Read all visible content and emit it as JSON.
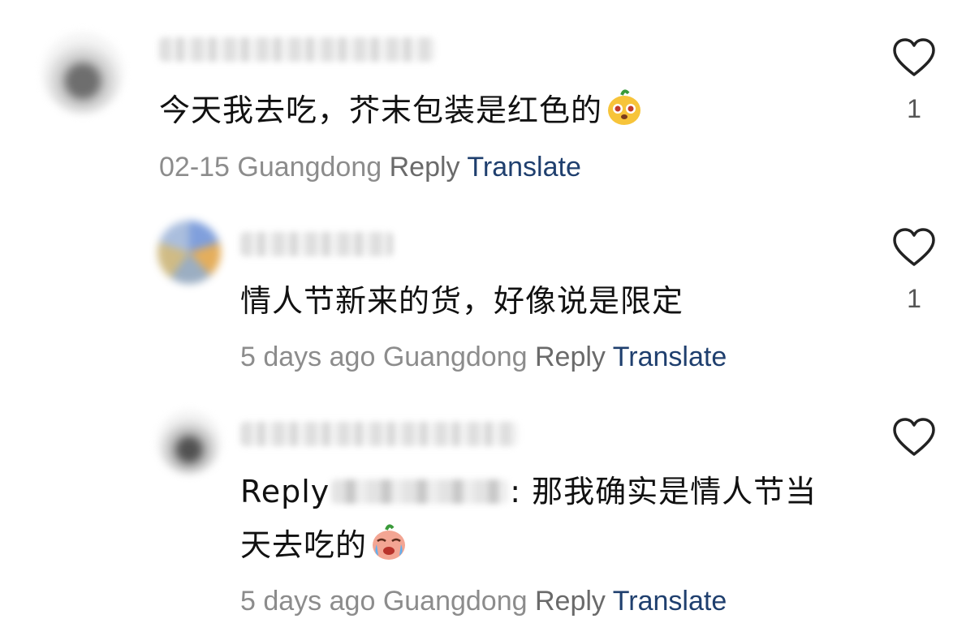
{
  "comments": [
    {
      "text": "今天我去吃，芥末包装是红色的",
      "emoji": "smiling-fruit-emoji",
      "date": "02-15",
      "location": "Guangdong",
      "reply_label": "Reply",
      "translate_label": "Translate",
      "likes": "1"
    },
    {
      "text": "情人节新来的货，好像说是限定",
      "date": "5 days ago",
      "location": "Guangdong",
      "reply_label": "Reply",
      "translate_label": "Translate",
      "likes": "1"
    },
    {
      "reply_prefix": "Reply",
      "text_line1": ": 那我确实是情人节当",
      "text_line2": "天去吃的",
      "emoji": "crying-fruit-emoji",
      "date": "5 days ago",
      "location": "Guangdong",
      "reply_label": "Reply",
      "translate_label": "Translate"
    }
  ],
  "colors": {
    "text": "#111111",
    "meta": "#8c8c8c",
    "reply": "#6a6a6a",
    "translate": "#1f3f6e",
    "heart": "#222222"
  }
}
